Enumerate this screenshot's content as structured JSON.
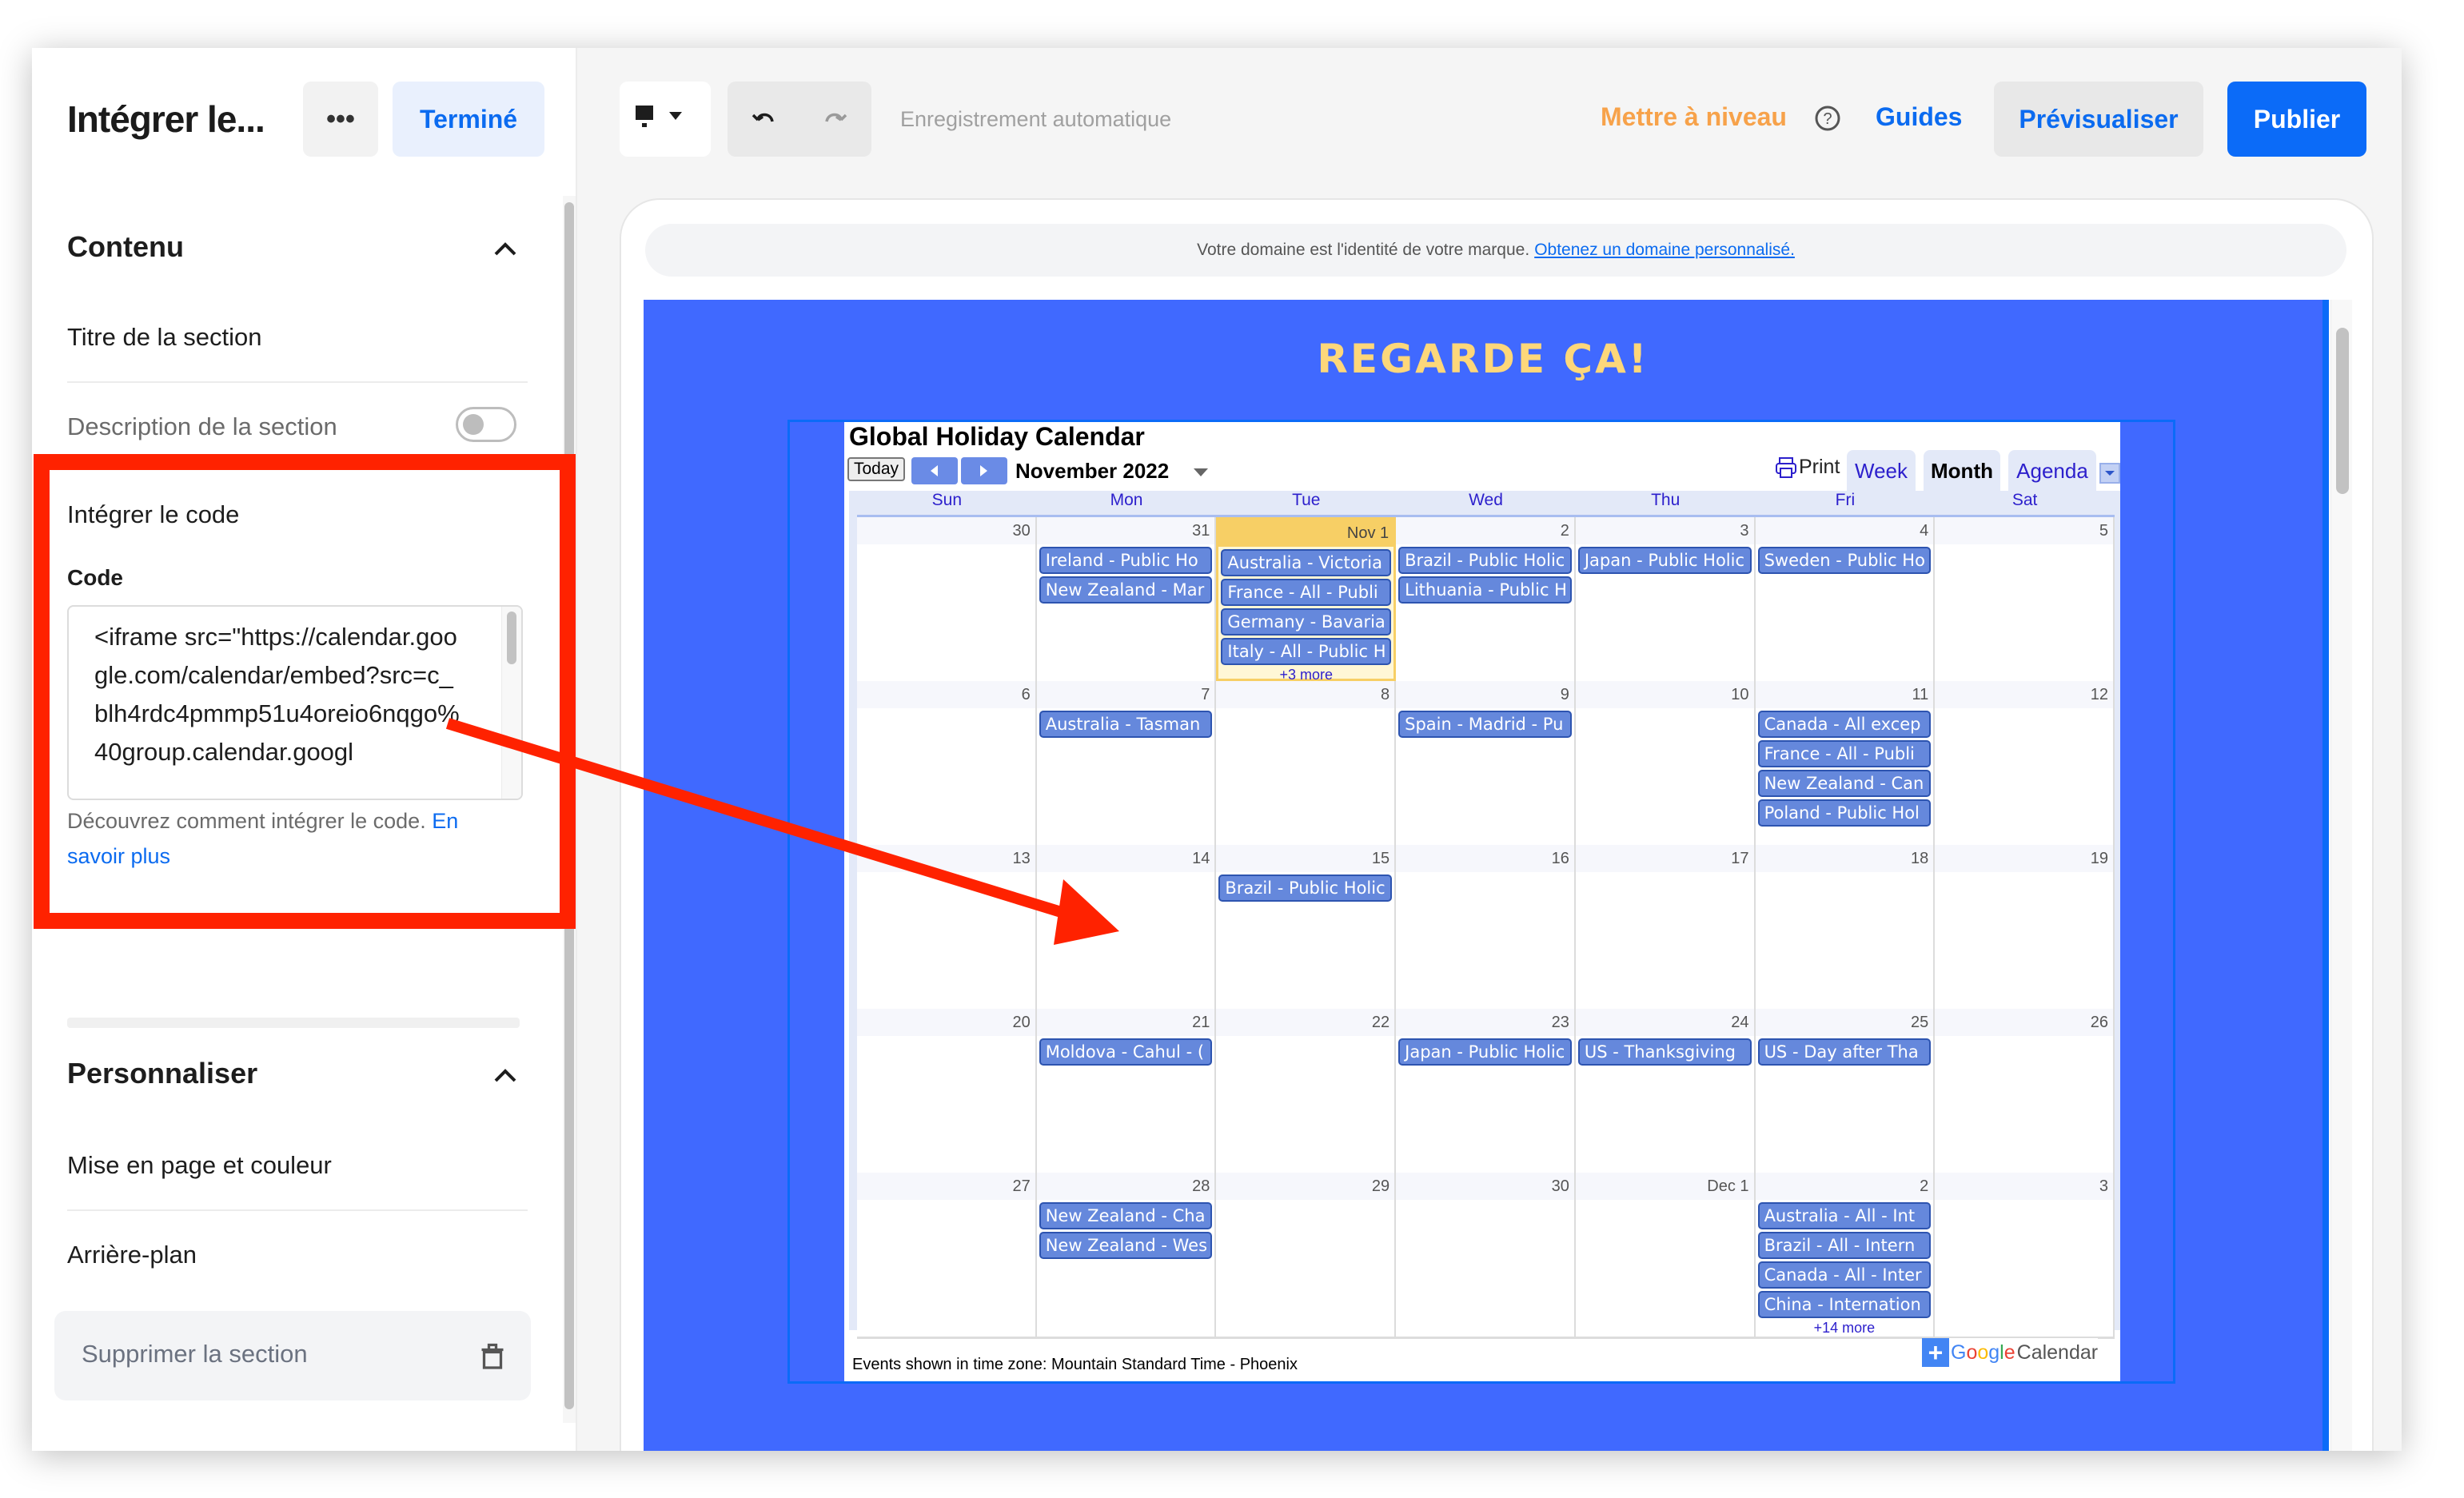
{
  "panel": {
    "title": "Intégrer le...",
    "more_label": "•••",
    "done_label": "Terminé",
    "content_section": {
      "heading": "Contenu",
      "section_title_label": "Titre de la section",
      "section_description_label": "Description de la section",
      "section_description_enabled": false,
      "embed_heading": "Intégrer le code",
      "code_label": "Code",
      "code_value": "<iframe src=\"https://calendar.google.com/calendar/embed?src=c_blh4rdc4pmmp51u4oreio6nqgo%40group.calendar.googl",
      "help_text": "Découvrez comment intégrer le code.",
      "help_link": "En savoir plus"
    },
    "customize_section": {
      "heading": "Personnaliser",
      "items": [
        "Mise en page et couleur",
        "Arrière-plan"
      ]
    },
    "delete_label": "Supprimer la section"
  },
  "toolbar": {
    "device_icon": "desktop-icon",
    "undo_icon": "undo-icon",
    "redo_icon": "redo-icon",
    "autosave_label": "Enregistrement automatique",
    "upgrade_label": "Mettre à niveau",
    "help_icon": "help-circle-icon",
    "guides_label": "Guides",
    "preview_label": "Prévisualiser",
    "publish_label": "Publier"
  },
  "canvas": {
    "domain_notice": "Votre domaine est l'identité de votre marque.",
    "domain_link": "Obtenez un domaine personnalisé.",
    "section_title": "REGARDE ÇA!",
    "section_bg_color": "#4069ff",
    "section_title_color": "#fdd77a"
  },
  "calendar": {
    "title": "Global Holiday Calendar",
    "today_label": "Today",
    "month_label": "November 2022",
    "print_label": "Print",
    "views": [
      "Week",
      "Month",
      "Agenda"
    ],
    "active_view": "Month",
    "weekdays": [
      "Sun",
      "Mon",
      "Tue",
      "Wed",
      "Thu",
      "Fri",
      "Sat"
    ],
    "weeks": [
      [
        {
          "num": "30",
          "events": []
        },
        {
          "num": "31",
          "events": [
            "Ireland - Public Ho",
            "New Zealand - Mar"
          ]
        },
        {
          "num": "Nov 1",
          "today": true,
          "events": [
            "Australia - Victoria",
            "France - All - Publi",
            "Germany - Bavaria",
            "Italy - All - Public H"
          ],
          "more": "+3 more"
        },
        {
          "num": "2",
          "events": [
            "Brazil - Public Holic",
            "Lithuania - Public H"
          ]
        },
        {
          "num": "3",
          "events": [
            "Japan - Public Holic"
          ]
        },
        {
          "num": "4",
          "events": [
            "Sweden - Public Ho"
          ]
        },
        {
          "num": "5",
          "events": []
        }
      ],
      [
        {
          "num": "6",
          "events": []
        },
        {
          "num": "7",
          "events": [
            "Australia - Tasman"
          ]
        },
        {
          "num": "8",
          "events": []
        },
        {
          "num": "9",
          "events": [
            "Spain - Madrid - Pu"
          ]
        },
        {
          "num": "10",
          "events": []
        },
        {
          "num": "11",
          "events": [
            "Canada - All excep",
            "France - All - Publi",
            "New Zealand - Can",
            "Poland - Public Hol"
          ]
        },
        {
          "num": "12",
          "events": []
        }
      ],
      [
        {
          "num": "13",
          "events": []
        },
        {
          "num": "14",
          "events": []
        },
        {
          "num": "15",
          "events": [
            "Brazil - Public Holic"
          ]
        },
        {
          "num": "16",
          "events": []
        },
        {
          "num": "17",
          "events": []
        },
        {
          "num": "18",
          "events": []
        },
        {
          "num": "19",
          "events": []
        }
      ],
      [
        {
          "num": "20",
          "events": []
        },
        {
          "num": "21",
          "events": [
            "Moldova - Cahul - ("
          ]
        },
        {
          "num": "22",
          "events": []
        },
        {
          "num": "23",
          "events": [
            "Japan - Public Holic"
          ]
        },
        {
          "num": "24",
          "events": [
            "US - Thanksgiving"
          ]
        },
        {
          "num": "25",
          "events": [
            "US - Day after Tha"
          ]
        },
        {
          "num": "26",
          "events": []
        }
      ],
      [
        {
          "num": "27",
          "events": []
        },
        {
          "num": "28",
          "events": [
            "New Zealand - Cha",
            "New Zealand - Wes"
          ]
        },
        {
          "num": "29",
          "events": []
        },
        {
          "num": "30",
          "events": []
        },
        {
          "num": "Dec 1",
          "events": []
        },
        {
          "num": "2",
          "events": [
            "Australia - All - Int",
            "Brazil - All - Intern",
            "Canada - All - Inter",
            "China - Internation"
          ],
          "more": "+14 more"
        },
        {
          "num": "3",
          "events": []
        }
      ]
    ],
    "timezone_note": "Events shown in time zone: Mountain Standard Time - Phoenix",
    "badge_plus": "+",
    "badge_google": "Google",
    "badge_calendar": "Calendar"
  },
  "annotation": {
    "highlight_color": "#ff2200"
  }
}
